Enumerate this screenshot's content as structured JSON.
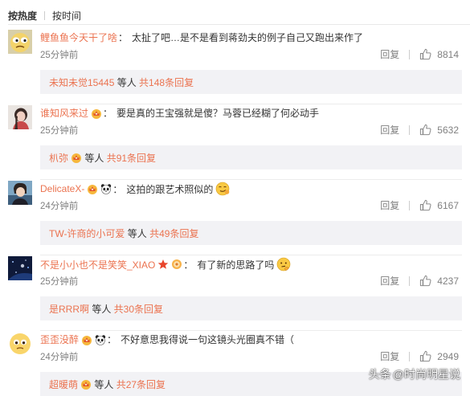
{
  "sort": {
    "hot_label": "按热度",
    "time_label": "按时间"
  },
  "comments": [
    {
      "user": "鲤鱼鱼今天干了啥",
      "badges": [],
      "colon": "：",
      "text": "太扯了吧…是不是看到蒋劲夫的例子自己又跑出来作了",
      "time": "25分钟前",
      "reply_label": "回复",
      "likes": "8814",
      "replies": {
        "names": "未知未觉15445",
        "badges": [],
        "suffix": " 等人 ",
        "more": "共148条回复"
      }
    },
    {
      "user": "谁知风来过",
      "badges": [
        "crown-badge-icon"
      ],
      "colon": "：",
      "text": "要是真的王宝强就是傻？马蓉已经糊了何必动手",
      "time": "25分钟前",
      "reply_label": "回复",
      "likes": "5632",
      "replies": {
        "names": "朳弥",
        "badges": [
          "crown-badge-icon"
        ],
        "suffix": " 等人 ",
        "more": "共91条回复"
      }
    },
    {
      "user": "DelicateX-",
      "badges": [
        "crown-badge-icon",
        "panda-badge-icon"
      ],
      "colon": "：",
      "text": "这拍的跟艺术照似的",
      "text_emoji": "smirk-emoji-icon",
      "time": "24分钟前",
      "reply_label": "回复",
      "likes": "6167",
      "replies": {
        "names": "TW-许商的小可爱",
        "badges": [],
        "suffix": " 等人 ",
        "more": "共49条回复"
      }
    },
    {
      "user": "不是小小也不是笑笑_XIAO",
      "badges": [
        "star-badge-icon",
        "flower-badge-icon"
      ],
      "colon": "：",
      "text": "有了新的思路了吗",
      "text_emoji": "thinking-emoji-icon",
      "time": "25分钟前",
      "reply_label": "回复",
      "likes": "4237",
      "replies": {
        "names": "是RRR啊",
        "badges": [],
        "suffix": " 等人 ",
        "more": "共30条回复"
      }
    },
    {
      "user": "歪歪没醉",
      "badges": [
        "crown-badge-icon",
        "panda-badge-icon"
      ],
      "colon": "：",
      "text": "不好意思我得说一句这镜头光圈真不错（",
      "time": "24分钟前",
      "reply_label": "回复",
      "likes": "2949",
      "replies": {
        "names": "超暖萌",
        "badges": [
          "crown-badge-icon"
        ],
        "suffix": " 等人 ",
        "more": "共27条回复"
      }
    }
  ],
  "watermark": {
    "prefix": "头条",
    "text": "@时尚明星说"
  },
  "colors": {
    "username": "#eb7350",
    "meta": "#808080",
    "reply_box": "#f2f2f5"
  }
}
